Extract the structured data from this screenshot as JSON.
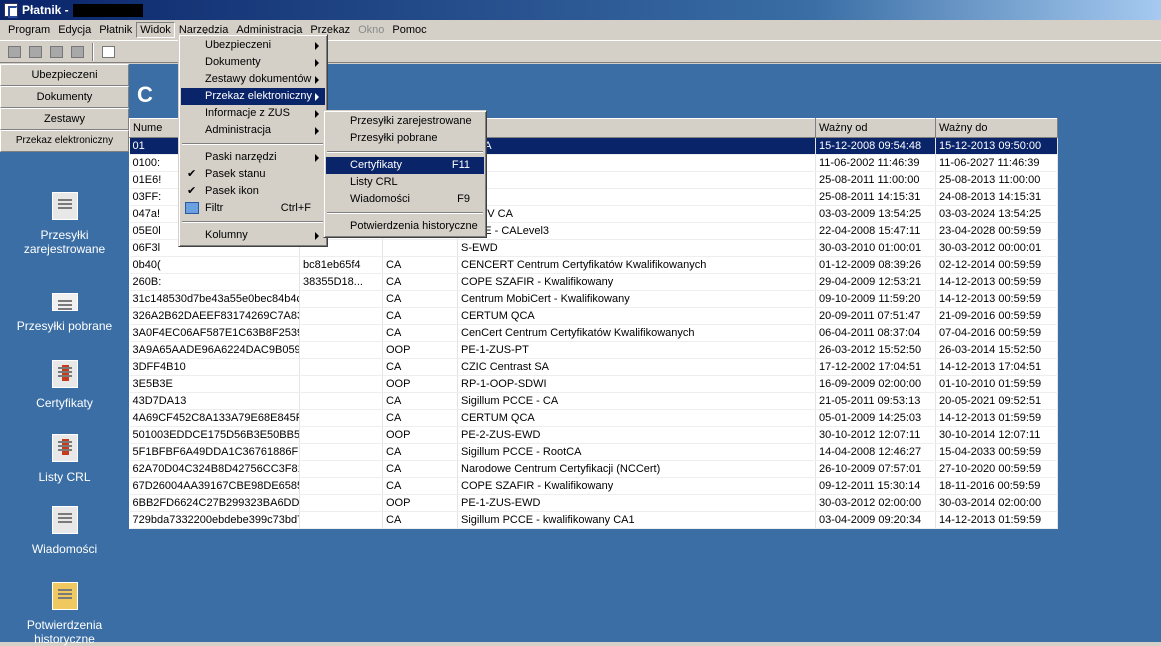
{
  "window": {
    "title": "Płatnik -"
  },
  "menubar": [
    "Program",
    "Edycja",
    "Płatnik",
    "Widok",
    "Narzędzia",
    "Administracja",
    "Przekaz",
    "Okno",
    "Pomoc"
  ],
  "nav_buttons": [
    "Ubezpieczeni",
    "Dokumenty",
    "Zestawy",
    "Przekaz elektroniczny"
  ],
  "sidebar": [
    {
      "label": "Przesyłki zarejestrowane",
      "icon": "registered-shipments-icon"
    },
    {
      "label": "Przesyłki pobrane",
      "icon": "envelope-icon"
    },
    {
      "label": "Certyfikaty",
      "icon": "certificate-icon"
    },
    {
      "label": "Listy CRL",
      "icon": "crl-list-icon"
    },
    {
      "label": "Wiadomości",
      "icon": "message-icon"
    },
    {
      "label": "Potwierdzenia historyczne",
      "icon": "historic-confirmation-icon"
    }
  ],
  "content": {
    "heading": "C"
  },
  "table": {
    "columns": [
      "Nume",
      "",
      "",
      "el",
      "Ważny od",
      "Ważny do"
    ],
    "rows": [
      [
        "01",
        "",
        "",
        "31 CA",
        "15-12-2008 09:54:48",
        "15-12-2013 09:50:00"
      ],
      [
        "0100:",
        "",
        "",
        "A",
        "11-06-2002 11:46:39",
        "11-06-2027 11:46:39"
      ],
      [
        "01E6!",
        "",
        "",
        "",
        "25-08-2011 11:00:00",
        "25-08-2013 11:00:00"
      ],
      [
        "03FF:",
        "",
        "",
        "",
        "25-08-2011 14:15:31",
        "24-08-2013 14:15:31"
      ],
      [
        "047a!",
        "",
        "",
        "evel IV CA",
        "03-03-2009 13:54:25",
        "03-03-2024 13:54:25"
      ],
      [
        "05E0l",
        "",
        "",
        "PCCE - CALevel3",
        "22-04-2008 15:47:11",
        "23-04-2028 00:59:59"
      ],
      [
        "06F3l",
        "",
        "",
        "S-EWD",
        "30-03-2010 01:00:01",
        "30-03-2012 00:00:01"
      ],
      [
        "0b40(",
        "bc81eb65f4",
        "CA",
        "CENCERT Centrum Certyfikatów Kwalifikowanych",
        "01-12-2009 08:39:26",
        "02-12-2014 00:59:59"
      ],
      [
        "260B:",
        "38355D18...",
        "CA",
        "COPE SZAFIR - Kwalifikowany",
        "29-04-2009 12:53:21",
        "14-12-2013 00:59:59"
      ],
      [
        "31c148530d7be43a55e0bec84b4c7a893a07961c",
        "",
        "CA",
        "Centrum MobiCert - Kwalifikowany",
        "09-10-2009 11:59:20",
        "14-12-2013 00:59:59"
      ],
      [
        "326A2B62DAEEF83174269C7A832A64B0818B...",
        "",
        "CA",
        "CERTUM QCA",
        "20-09-2011 07:51:47",
        "21-09-2016 00:59:59"
      ],
      [
        "3A0F4EC06AF587E1C63B8F2539A69A4C1345...",
        "",
        "CA",
        "CenCert Centrum Certyfikatów Kwalifikowanych",
        "06-04-2011 08:37:04",
        "07-04-2016 00:59:59"
      ],
      [
        "3A9A65AADE96A6224DAC9B0597B92387",
        "",
        "OOP",
        "PE-1-ZUS-PT",
        "26-03-2012 15:52:50",
        "26-03-2014 15:52:50"
      ],
      [
        "3DFF4B10",
        "",
        "CA",
        "CZIC Centrast SA",
        "17-12-2002 17:04:51",
        "14-12-2013 17:04:51"
      ],
      [
        "3E5B3E",
        "",
        "OOP",
        "RP-1-OOP-SDWI",
        "16-09-2009 02:00:00",
        "01-10-2010 01:59:59"
      ],
      [
        "43D7DA13",
        "",
        "CA",
        "Sigillum PCCE - CA",
        "21-05-2011 09:53:13",
        "20-05-2021 09:52:51"
      ],
      [
        "4A69CF452C8A133A79E68E845FE11688F6D9...",
        "",
        "CA",
        "CERTUM QCA",
        "05-01-2009 14:25:03",
        "14-12-2013 01:59:59"
      ],
      [
        "501003EDDCE175D56B3E50BB5C6FB78F",
        "",
        "OOP",
        "PE-2-ZUS-EWD",
        "30-10-2012 12:07:11",
        "30-10-2014 12:07:11"
      ],
      [
        "5F1BFBF6A49DDA1C36761886FE8412F3333E...",
        "",
        "CA",
        "Sigillum PCCE - RootCA",
        "14-04-2008 12:46:27",
        "15-04-2033 00:59:59"
      ],
      [
        "62A70D04C324B8D42756CC3F816BF2E832EF...",
        "",
        "CA",
        "Narodowe Centrum Certyfikacji (NCCert)",
        "26-10-2009 07:57:01",
        "27-10-2020 00:59:59"
      ],
      [
        "67D26004AA39167CBE98DE6585DF8F8F7133...",
        "",
        "CA",
        "COPE SZAFIR - Kwalifikowany",
        "09-12-2011 15:30:14",
        "18-11-2016 00:59:59"
      ],
      [
        "6BB2FD6624C27B299323BA6DDA53B68B",
        "",
        "OOP",
        "PE-1-ZUS-EWD",
        "30-03-2012 02:00:00",
        "30-03-2014 02:00:00"
      ],
      [
        "729bda7332200ebdebe399c73bd7ca224429e31d",
        "",
        "CA",
        "Sigillum PCCE - kwalifikowany CA1",
        "03-04-2009 09:20:34",
        "14-12-2013 01:59:59"
      ]
    ]
  },
  "widok_menu": [
    {
      "label": "Ubezpieczeni",
      "submenu": true
    },
    {
      "label": "Dokumenty",
      "submenu": true
    },
    {
      "label": "Zestawy dokumentów",
      "submenu": true
    },
    {
      "label": "Przekaz elektroniczny",
      "submenu": true,
      "highlighted": true
    },
    {
      "label": "Informacje z ZUS",
      "submenu": true
    },
    {
      "label": "Administracja",
      "submenu": true
    },
    {
      "separator": true
    },
    {
      "label": "Paski narzędzi",
      "submenu": true
    },
    {
      "label": "Pasek stanu",
      "checked": "✔"
    },
    {
      "label": "Pasek ikon",
      "checked": "✔"
    },
    {
      "label": "Filtr",
      "shortcut": "Ctrl+F",
      "icon": "filter-icon"
    },
    {
      "separator": true
    },
    {
      "label": "Kolumny",
      "submenu": true
    }
  ],
  "przekaz_submenu": [
    {
      "label": "Przesyłki zarejestrowane"
    },
    {
      "label": "Przesyłki pobrane"
    },
    {
      "separator": true
    },
    {
      "label": "Certyfikaty",
      "shortcut": "F11",
      "highlighted": true
    },
    {
      "label": "Listy CRL"
    },
    {
      "label": "Wiadomości",
      "shortcut": "F9"
    },
    {
      "separator": true
    },
    {
      "label": "Potwierdzenia historyczne"
    }
  ]
}
